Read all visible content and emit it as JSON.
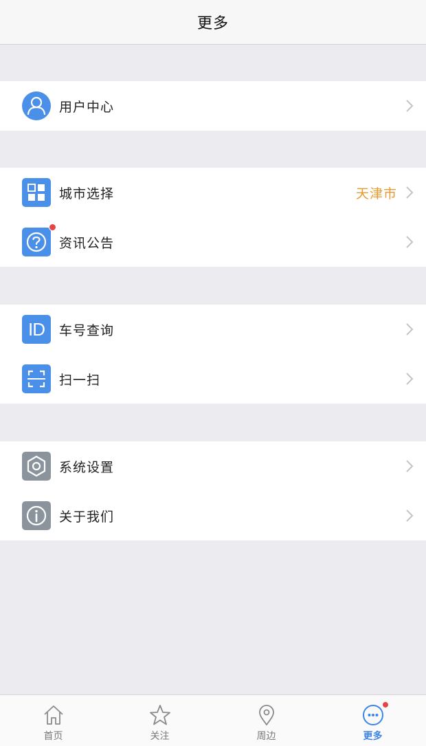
{
  "header": {
    "title": "更多"
  },
  "sections": {
    "user": {
      "label": "用户中心",
      "icon": "user-icon"
    },
    "city": {
      "label": "城市选择",
      "value": "天津市",
      "icon": "grid-icon"
    },
    "news": {
      "label": "资讯公告",
      "icon": "question-icon",
      "has_badge": true
    },
    "bus_id": {
      "label": "车号查询",
      "icon_text": "ID",
      "icon": "id-icon"
    },
    "scan": {
      "label": "扫一扫",
      "icon": "scan-icon"
    },
    "settings": {
      "label": "系统设置",
      "icon": "gear-icon"
    },
    "about": {
      "label": "关于我们",
      "icon": "info-icon"
    }
  },
  "tabbar": {
    "items": [
      {
        "label": "首页",
        "icon": "home-icon",
        "active": false
      },
      {
        "label": "关注",
        "icon": "star-icon",
        "active": false
      },
      {
        "label": "周边",
        "icon": "location-pin-icon",
        "active": false
      },
      {
        "label": "更多",
        "icon": "more-icon",
        "active": true,
        "has_badge": true
      }
    ]
  },
  "colors": {
    "accent": "#4a90e8",
    "city_value": "#e99a2f",
    "badge": "#e54545",
    "background": "#ebebf0",
    "icon_gray": "#8b949d"
  }
}
